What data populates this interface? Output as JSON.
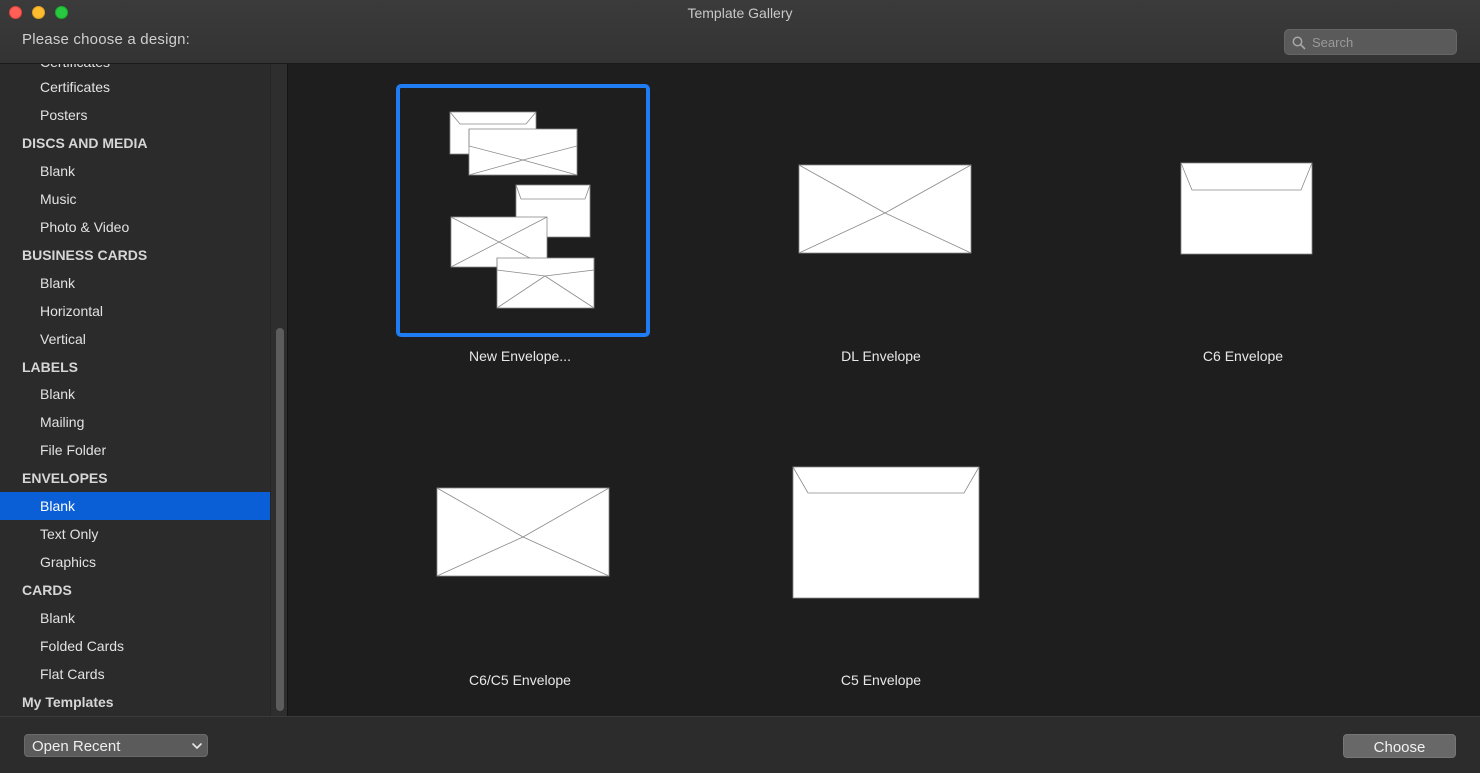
{
  "window": {
    "title": "Template Gallery",
    "prompt": "Please choose a design:"
  },
  "search": {
    "placeholder": "Search"
  },
  "sidebar": {
    "cut_off_item": "Certificates",
    "rows": [
      {
        "type": "item",
        "label": "Certificates"
      },
      {
        "type": "item",
        "label": "Posters"
      },
      {
        "type": "head",
        "label": "DISCS AND MEDIA"
      },
      {
        "type": "item",
        "label": "Blank"
      },
      {
        "type": "item",
        "label": "Music"
      },
      {
        "type": "item",
        "label": "Photo & Video"
      },
      {
        "type": "head",
        "label": "BUSINESS CARDS"
      },
      {
        "type": "item",
        "label": "Blank"
      },
      {
        "type": "item",
        "label": "Horizontal"
      },
      {
        "type": "item",
        "label": "Vertical"
      },
      {
        "type": "head",
        "label": "LABELS"
      },
      {
        "type": "item",
        "label": "Blank"
      },
      {
        "type": "item",
        "label": "Mailing"
      },
      {
        "type": "item",
        "label": "File Folder"
      },
      {
        "type": "head",
        "label": "ENVELOPES"
      },
      {
        "type": "item",
        "label": "Blank",
        "selected": true
      },
      {
        "type": "item",
        "label": "Text Only"
      },
      {
        "type": "item",
        "label": "Graphics"
      },
      {
        "type": "head",
        "label": "CARDS"
      },
      {
        "type": "item",
        "label": "Blank"
      },
      {
        "type": "item",
        "label": "Folded Cards"
      },
      {
        "type": "item",
        "label": "Flat Cards"
      },
      {
        "type": "head",
        "label": "My Templates"
      }
    ]
  },
  "templates": [
    {
      "name": "New Envelope...",
      "selected": true
    },
    {
      "name": "DL Envelope"
    },
    {
      "name": "C6 Envelope"
    },
    {
      "name": "C6/C5 Envelope"
    },
    {
      "name": "C5 Envelope"
    }
  ],
  "footer": {
    "open_recent": "Open Recent",
    "choose": "Choose"
  },
  "colors": {
    "selection": "#0a5fd6",
    "selection_frame": "#1f7cf2",
    "background": "#1e1e1e"
  },
  "icons": {
    "search": "magnifier-icon",
    "popup": "chevron-updown-icon"
  }
}
